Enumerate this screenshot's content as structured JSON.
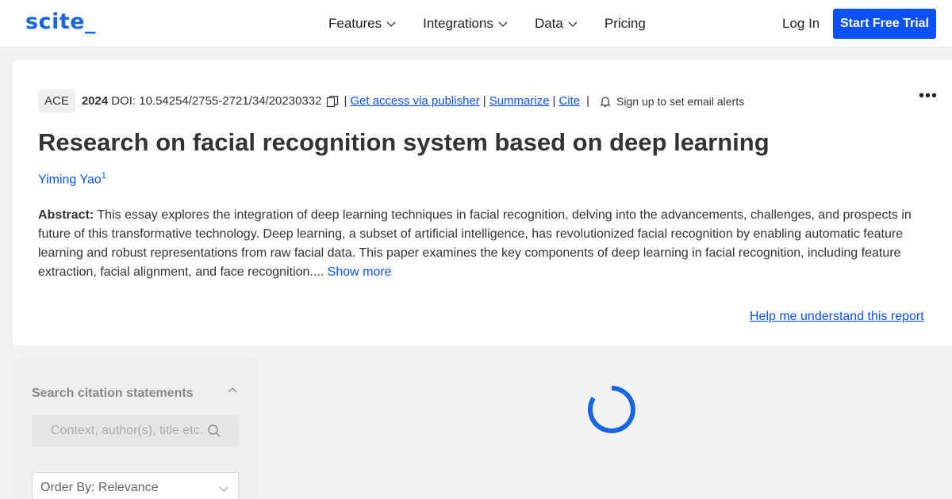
{
  "nav": {
    "logo": "scite_",
    "menu": [
      {
        "label": "Features",
        "has_dropdown": true,
        "icon": "chevron-down-icon"
      },
      {
        "label": "Integrations",
        "has_dropdown": true,
        "icon": "chevron-down-icon"
      },
      {
        "label": "Data",
        "has_dropdown": true,
        "icon": "chevron-down-icon"
      },
      {
        "label": "Pricing",
        "has_dropdown": false
      }
    ],
    "login": "Log In",
    "cta": "Start Free Trial"
  },
  "paper": {
    "journal": "ACE",
    "year": "2024",
    "doi": "DOI: 10.54254/2755-2721/34/20230332",
    "links": {
      "publisher": "Get access via publisher",
      "summarize": "Summarize",
      "cite": "Cite"
    },
    "separators": [
      "|",
      "|",
      "|",
      "|"
    ],
    "alert": "Sign up to set email alerts",
    "title": "Research on facial recognition system based on deep learning",
    "author": {
      "name": "Yiming Yao",
      "affiliation_index": "1"
    },
    "abstract_label": "Abstract:",
    "abstract_text": " This essay explores the integration of deep learning techniques in facial recognition, delving into the advancements, challenges, and prospects in future of this transformative technology. Deep learning, a subset of artificial intelligence, has revolutionized facial recognition by enabling automatic feature learning and robust representations from raw facial data. This paper examines the key components of deep learning in facial recognition, including feature extraction, facial alignment, and face recognition....",
    "show_more": "Show more",
    "help_link": "Help me understand this report",
    "more_menu": "•••"
  },
  "sidebar": {
    "search_title": "Search citation statements",
    "search_placeholder": "Context, author(s), title etc.",
    "order_by": "Order By: Relevance"
  },
  "colors": {
    "accent": "#0a52f5",
    "logo": "#1565e8",
    "background": "#f3f3f3",
    "spinner": "#1565e8"
  },
  "icons": [
    "chevron-down-icon",
    "copy-icon",
    "bell-icon",
    "more-options-icon",
    "chevron-up-icon",
    "search-icon",
    "loading-spinner-icon"
  ]
}
